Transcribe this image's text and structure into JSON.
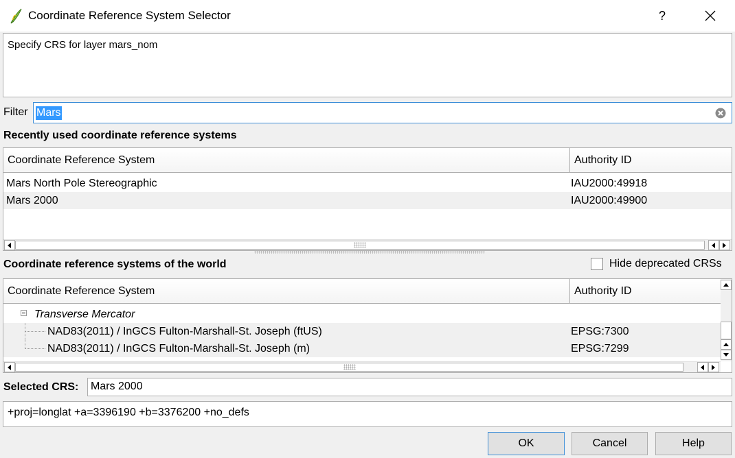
{
  "window": {
    "title": "Coordinate Reference System Selector",
    "help_label": "?",
    "close_label": "×"
  },
  "message": "Specify CRS for layer mars_nom",
  "filter": {
    "label": "Filter",
    "value": "Mars"
  },
  "recent": {
    "heading": "Recently used coordinate reference systems",
    "columns": [
      "Coordinate Reference System",
      "Authority ID"
    ],
    "rows": [
      {
        "name": "Mars North Pole Stereographic",
        "id": "IAU2000:49918"
      },
      {
        "name": "Mars 2000",
        "id": "IAU2000:49900"
      }
    ]
  },
  "world": {
    "heading": "Coordinate reference systems of the world",
    "hide_deprecated_label": "Hide deprecated CRSs",
    "hide_deprecated_checked": false,
    "columns": [
      "Coordinate Reference System",
      "Authority ID"
    ],
    "group": "Transverse Mercator",
    "rows": [
      {
        "name": "NAD83(2011) / InGCS Fulton-Marshall-St. Joseph (ftUS)",
        "id": "EPSG:7300"
      },
      {
        "name": "NAD83(2011) / InGCS Fulton-Marshall-St. Joseph (m)",
        "id": "EPSG:7299"
      }
    ]
  },
  "selected": {
    "label": "Selected CRS:",
    "value": "Mars 2000"
  },
  "proj_string": "+proj=longlat +a=3396190 +b=3376200 +no_defs",
  "buttons": {
    "ok": "OK",
    "cancel": "Cancel",
    "help": "Help"
  },
  "colors": {
    "accent": "#3399ff",
    "focus_border": "#3c8ed8",
    "logo_green": "#6aa84f"
  }
}
